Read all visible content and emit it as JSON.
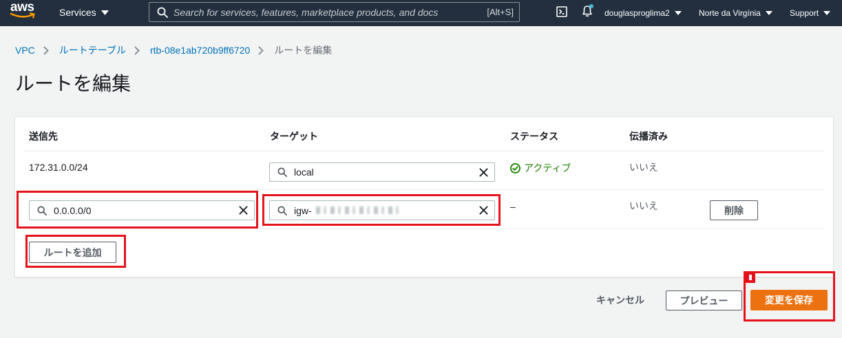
{
  "nav": {
    "logo_text": "aws",
    "services_label": "Services",
    "search_placeholder": "Search for services, features, marketplace products, and docs",
    "search_shortcut": "[Alt+S]",
    "account_label": "douglasproglima2",
    "region_label": "Norte da Virgínia",
    "support_label": "Support"
  },
  "breadcrumb": [
    {
      "label": "VPC"
    },
    {
      "label": "ルートテーブル"
    },
    {
      "label": "rtb-08e1ab720b9ff6720"
    },
    {
      "label": "ルートを編集"
    }
  ],
  "page_title": "ルートを編集",
  "routes_table": {
    "headers": {
      "destination": "送信先",
      "target": "ターゲット",
      "status": "ステータス",
      "propagated": "伝播済み"
    },
    "rows": [
      {
        "destination": "172.31.0.0/24",
        "target": "local",
        "status": "アクティブ",
        "status_icon": "check-circle-icon",
        "propagated": "いいえ"
      },
      {
        "destination": "0.0.0.0/0",
        "target": "igw-",
        "status": "–",
        "propagated": "いいえ",
        "remove_label": "削除"
      }
    ]
  },
  "add_route_label": "ルートを追加",
  "footer": {
    "cancel_label": "キャンセル",
    "preview_label": "プレビュー",
    "save_label": "変更を保存"
  },
  "colors": {
    "nav_bg": "#232f3e",
    "page_bg": "#f2f3f3",
    "link": "#0073bb",
    "status_active": "#1d8102",
    "primary_button": "#ec7211",
    "annotation": "#e5121b"
  }
}
